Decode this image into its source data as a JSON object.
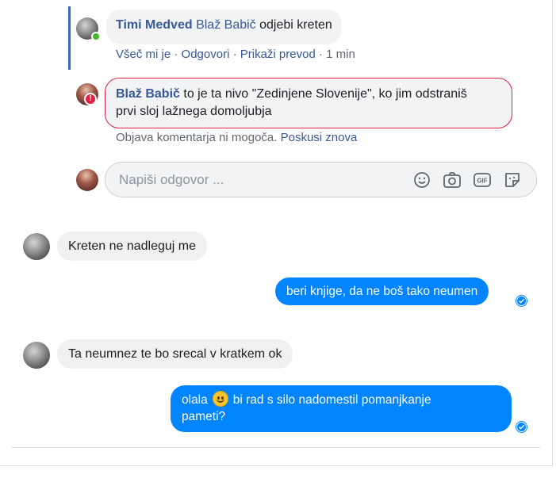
{
  "comment1": {
    "author": "Timi Medved",
    "mention": "Blaž Babič",
    "text": " odjebi kreten",
    "actions": {
      "like": "Všeč mi je",
      "sep1": " · ",
      "reply": "Odgovori",
      "sep2": " · ",
      "translate": "Prikaži prevod",
      "sep3": " · ",
      "time": "1 min"
    }
  },
  "comment2": {
    "author": "Blaž Babič",
    "line1": " to je ta nivo \"Zedinjene Slovenije\", ko jim odstraniš",
    "line2": "prvi sloj lažnega domoljubja",
    "error": "Objava komentarja ni mogoča.",
    "retry": "Poskusi znova",
    "error_badge": "!"
  },
  "reply": {
    "placeholder": "Napiši odgovor ...",
    "icons": [
      "smiley-icon",
      "camera-icon",
      "gif-icon",
      "sticker-icon"
    ]
  },
  "messages": [
    {
      "direction": "in",
      "text": "Kreten ne nadleguj me"
    },
    {
      "direction": "out",
      "text": "beri knjige, da ne boš tako neumen"
    },
    {
      "direction": "in",
      "text": "Ta neumnez te bo srecal v kratkem ok"
    },
    {
      "direction": "out",
      "text_a": "olala",
      "emoji": "slightly-smiling-face",
      "text_b": "bi rad s silo nadomestil pomanjkanje",
      "text_c": "pameti?"
    }
  ],
  "colors": {
    "accent": "#4267b2",
    "link": "#385898",
    "outgoing": "#0084ff",
    "error": "#e41e3f",
    "online": "#42b72a"
  }
}
